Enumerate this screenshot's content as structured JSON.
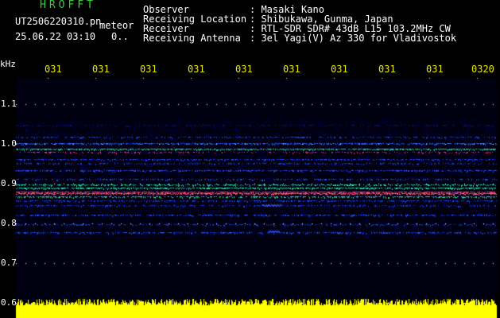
{
  "header": {
    "brand": "HROFFT",
    "filename": "UT2506220310.pn",
    "mode_label": "meteor",
    "datetime": "25.06.22 03:10",
    "indicator": "0..",
    "fields": [
      {
        "label": "Observer",
        "value": ": Masaki Kano"
      },
      {
        "label": "Receiving Location",
        "value": ": Shibukawa, Gunma, Japan"
      },
      {
        "label": "Receiver",
        "value": ": RTL-SDR SDR# 43dB L15 103.2MHz CW"
      },
      {
        "label": "Receiving Antenna",
        "value": ": 3el Yagi(V) Az 330 for Vladivostok"
      }
    ]
  },
  "axes": {
    "unit": "kHz",
    "y_ticks": [
      "1.1",
      "1.0",
      "0.9",
      "0.8",
      "0.7",
      "0.6"
    ],
    "x_ticks": [
      "031",
      "031",
      "031",
      "031",
      "031",
      "031",
      "031",
      "031",
      "031",
      "0320"
    ]
  },
  "colors": {
    "background": "#000000",
    "header_text": "#ffffff",
    "brand": "#2bd62b",
    "axis_labels": "#e8e800",
    "noise_trace": "#ffff00",
    "signal_strong": "#ff3070",
    "signal_mid": "#20e0a0",
    "signal_low": "#3050ff"
  }
}
